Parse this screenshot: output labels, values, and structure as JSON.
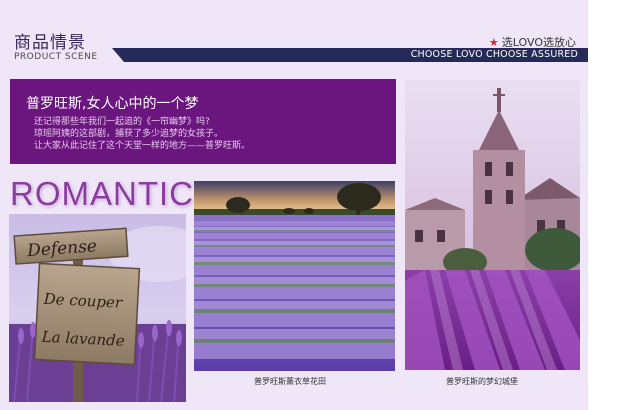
{
  "header": {
    "title_cn": "商品情景",
    "title_en": "PRODUCT SCENE",
    "slogan": "选LOVO选放心",
    "bar_text": "CHOOSE LOVO CHOOSE ASSURED"
  },
  "intro": {
    "title": "普罗旺斯,女人心中的一个梦",
    "lines": [
      "还记得那些年我们一起追的《一帘幽梦》吗?",
      "琼瑶阿姨的这部剧，捕获了多少追梦的女孩子。",
      "让大家从此记住了这个天堂一样的地方——普罗旺斯。"
    ]
  },
  "romantic": "ROMANTIC",
  "sign": {
    "top": "Defense",
    "line1": "De couper",
    "line2": "La lavande"
  },
  "captions": {
    "field": "普罗旺斯薰衣草花田",
    "castle": "普罗旺斯的梦幻城堡"
  },
  "colors": {
    "panel_bg": "#efe6f8",
    "accent_purple": "#6b167e",
    "header_bar": "#252a58",
    "star": "#d4243c"
  },
  "icons": [
    "star-icon"
  ]
}
